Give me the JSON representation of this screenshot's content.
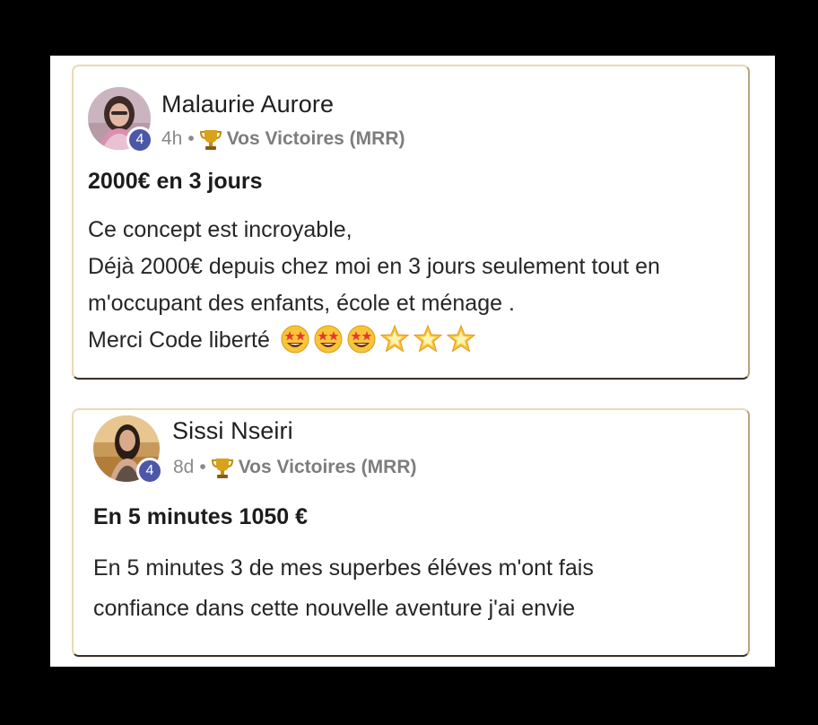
{
  "posts": [
    {
      "author": "Malaurie Aurore",
      "level": "4",
      "time": "4h",
      "separator": "•",
      "group": "Vos Victoires (MRR)",
      "title": "2000€ en 3 jours",
      "lines": [
        "Ce concept est incroyable,",
        "Déjà 2000€ depuis chez moi en 3 jours seulement tout en",
        "m'occupant des enfants, école et ménage .",
        "Merci Code liberté"
      ],
      "emojis": [
        "star-struck",
        "star-struck",
        "star-struck",
        "glowing-star",
        "glowing-star",
        "glowing-star"
      ]
    },
    {
      "author": "Sissi Nseiri",
      "level": "4",
      "time": "8d",
      "separator": "•",
      "group": "Vos Victoires (MRR)",
      "title": "En 5 minutes 1050 €",
      "lines": [
        "En 5 minutes 3 de mes superbes éléves m'ont fais",
        "confiance dans cette nouvelle aventure j'ai envie"
      ]
    }
  ],
  "colors": {
    "badge": "#4b57a8",
    "card_border": "#e9d9b8",
    "meta_text": "#8a8a8a",
    "trophy": "#d9a21b"
  }
}
